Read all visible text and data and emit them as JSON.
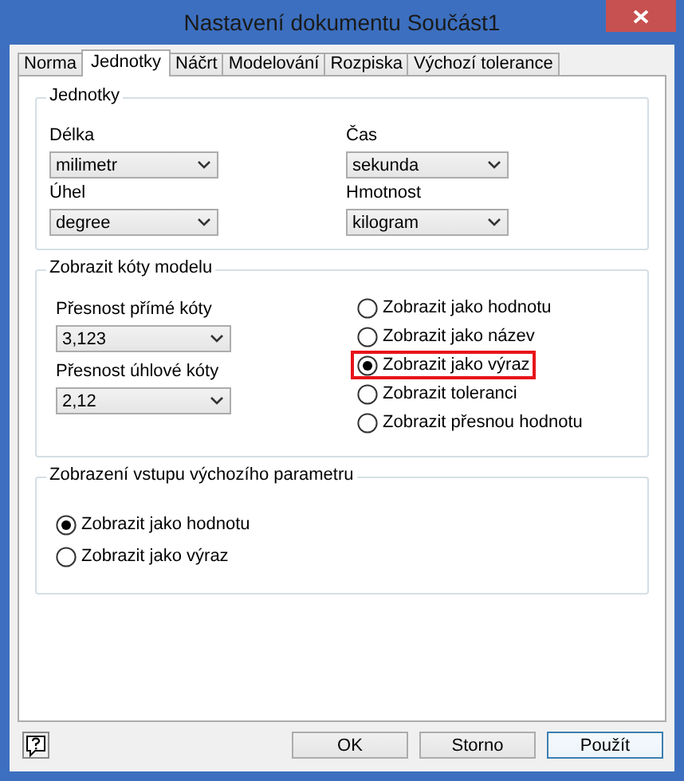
{
  "window": {
    "title": "Nastavení dokumentu Součást1"
  },
  "tabs": [
    {
      "label": "Norma",
      "selected": false
    },
    {
      "label": "Jednotky",
      "selected": true
    },
    {
      "label": "Náčrt",
      "selected": false
    },
    {
      "label": "Modelování",
      "selected": false
    },
    {
      "label": "Rozpiska",
      "selected": false
    },
    {
      "label": "Výchozí tolerance",
      "selected": false
    }
  ],
  "units_group": {
    "title": "Jednotky",
    "fields": [
      {
        "label": "Délka",
        "value": "milimetr"
      },
      {
        "label": "Čas",
        "value": "sekunda"
      },
      {
        "label": "Úhel",
        "value": "degree"
      },
      {
        "label": "Hmotnost",
        "value": "kilogram"
      }
    ]
  },
  "dimension_group": {
    "title": "Zobrazit kóty modelu",
    "fields": [
      {
        "label": "Přesnost přímé kóty",
        "value": "3,123"
      },
      {
        "label": "Přesnost úhlové kóty",
        "value": "2,12"
      }
    ],
    "options": [
      {
        "label": "Zobrazit jako hodnotu",
        "selected": false,
        "highlighted": false
      },
      {
        "label": "Zobrazit jako název",
        "selected": false,
        "highlighted": false
      },
      {
        "label": "Zobrazit jako výraz",
        "selected": true,
        "highlighted": true
      },
      {
        "label": "Zobrazit toleranci",
        "selected": false,
        "highlighted": false
      },
      {
        "label": "Zobrazit přesnou hodnotu",
        "selected": false,
        "highlighted": false
      }
    ]
  },
  "parameter_group": {
    "title": "Zobrazení vstupu výchozího parametru",
    "options": [
      {
        "label": "Zobrazit jako hodnotu",
        "selected": true
      },
      {
        "label": "Zobrazit jako výraz",
        "selected": false
      }
    ]
  },
  "buttons": [
    {
      "label": "OK",
      "focused": false
    },
    {
      "label": "Storno",
      "focused": false
    },
    {
      "label": "Použít",
      "focused": true
    }
  ]
}
